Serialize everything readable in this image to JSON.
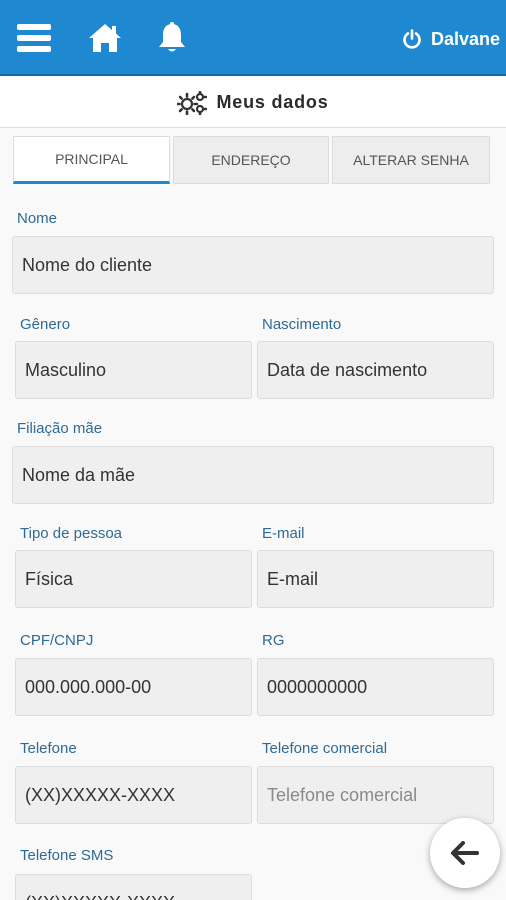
{
  "header": {
    "user_name": "Dalvane",
    "icons": [
      "menu-icon",
      "home-icon",
      "bell-icon",
      "power-icon"
    ]
  },
  "page": {
    "title": "Meus dados",
    "title_icon": "gears-icon"
  },
  "tabs": [
    {
      "label": "PRINCIPAL",
      "active": true
    },
    {
      "label": "ENDEREÇO",
      "active": false
    },
    {
      "label": "ALTERAR SENHA",
      "active": false
    }
  ],
  "form": {
    "nome": {
      "label": "Nome",
      "value": "Nome do cliente"
    },
    "genero": {
      "label": "Gênero",
      "value": "Masculino"
    },
    "nascimento": {
      "label": "Nascimento",
      "value": "Data de nascimento"
    },
    "filiacao_mae": {
      "label": "Filiação mãe",
      "value": "Nome da mãe"
    },
    "tipo_pessoa": {
      "label": "Tipo de pessoa",
      "value": "Física"
    },
    "email": {
      "label": "E-mail",
      "value": "E-mail"
    },
    "cpf_cnpj": {
      "label": "CPF/CNPJ",
      "value": "000.000.000-00"
    },
    "rg": {
      "label": "RG",
      "value": "0000000000"
    },
    "telefone": {
      "label": "Telefone",
      "value": "(XX)XXXXX-XXXX"
    },
    "telefone_comercial": {
      "label": "Telefone comercial",
      "placeholder": "Telefone comercial"
    },
    "telefone_sms": {
      "label": "Telefone SMS",
      "value": "(XX)XXXXX-XXXX"
    }
  },
  "actions": {
    "back_icon": "arrow-left-icon"
  },
  "colors": {
    "header_bg": "#1e88d0",
    "label_text": "#2f6a96",
    "field_bg": "#efefef",
    "active_tab_underline": "#1e88d0"
  }
}
